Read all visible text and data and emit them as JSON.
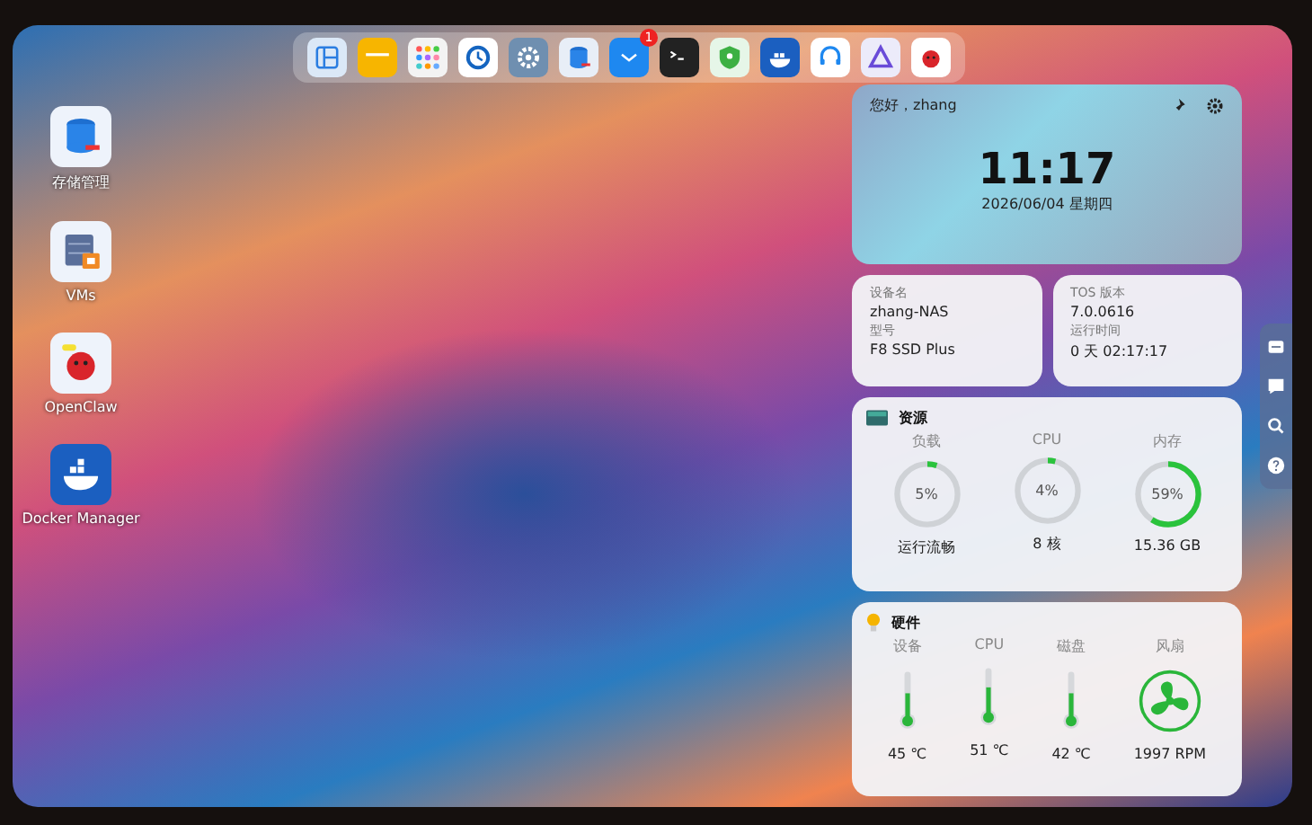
{
  "dock": {
    "items": [
      {
        "kind": "panels"
      },
      {
        "kind": "folder"
      },
      {
        "kind": "apps"
      },
      {
        "kind": "clock"
      },
      {
        "kind": "gear"
      },
      {
        "kind": "storage"
      },
      {
        "kind": "inbox",
        "badge": "1"
      },
      {
        "kind": "terminal"
      },
      {
        "kind": "shield"
      },
      {
        "kind": "whale"
      },
      {
        "kind": "headset"
      },
      {
        "kind": "triangle"
      },
      {
        "kind": "bird"
      }
    ]
  },
  "desktop_icons": [
    {
      "kind": "storage",
      "label": "存储管理"
    },
    {
      "kind": "vm",
      "label": "VMs"
    },
    {
      "kind": "bird",
      "label": "OpenClaw"
    },
    {
      "kind": "whale",
      "label": "Docker Manager"
    }
  ],
  "clock_widget": {
    "greeting": "您好，zhang",
    "time": "11:17",
    "date": "2026/06/04 星期四"
  },
  "device_info": [
    {
      "label": "设备名",
      "value": "zhang-NAS"
    },
    {
      "label": "型号",
      "value": "F8 SSD Plus"
    }
  ],
  "system_info": [
    {
      "label": "TOS 版本",
      "value": "7.0.0616"
    },
    {
      "label": "运行时间",
      "value": "0 天 02:17:17"
    }
  ],
  "resources": {
    "title": "资源",
    "gauges": [
      {
        "label": "负载",
        "reading": "5%",
        "level": 0.05,
        "caption": "运行流畅"
      },
      {
        "label": "CPU",
        "reading": "4%",
        "level": 0.04,
        "caption": "8 核"
      },
      {
        "label": "内存",
        "reading": "59%",
        "level": 0.59,
        "caption": "15.36 GB"
      }
    ]
  },
  "hardware": {
    "title": "硬件",
    "sensors": [
      {
        "kind": "thermometer",
        "label": "设备",
        "level": 0.6,
        "reading": "45 ℃"
      },
      {
        "kind": "thermometer",
        "label": "CPU",
        "level": 0.65,
        "reading": "51 ℃"
      },
      {
        "kind": "thermometer",
        "label": "磁盘",
        "level": 0.6,
        "reading": "42 ℃"
      },
      {
        "kind": "fan",
        "label": "风扇",
        "reading": "1997 RPM"
      }
    ]
  },
  "side_bar": {
    "items": [
      {
        "kind": "message"
      },
      {
        "kind": "chat"
      },
      {
        "kind": "search"
      },
      {
        "kind": "help"
      }
    ]
  }
}
